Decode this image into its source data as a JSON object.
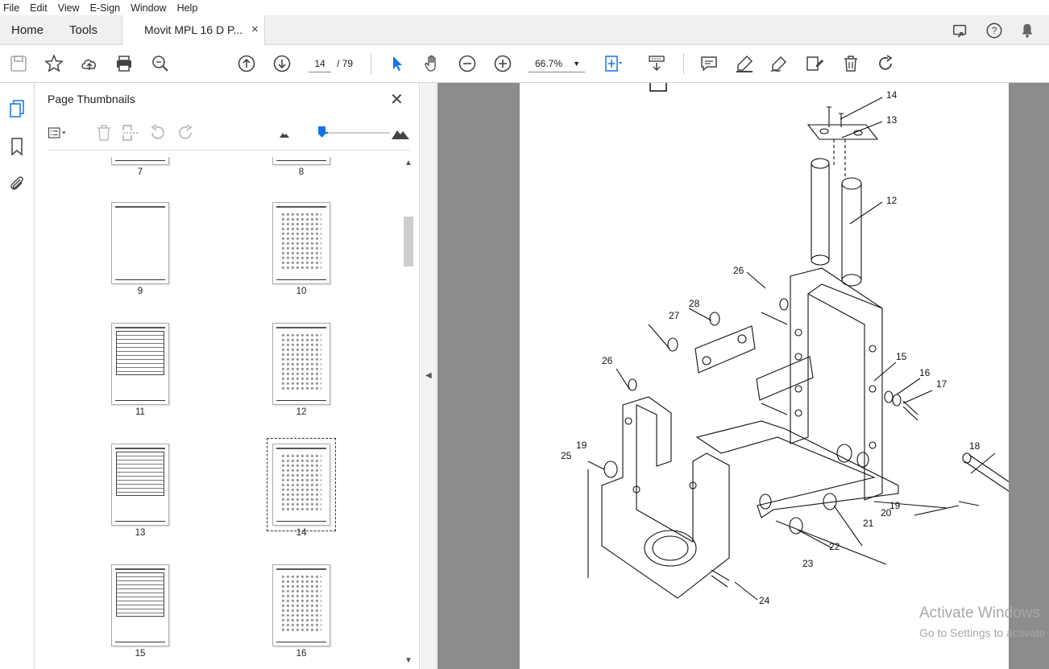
{
  "menu": [
    "File",
    "Edit",
    "View",
    "E-Sign",
    "Window",
    "Help"
  ],
  "tabs": {
    "home": "Home",
    "tools": "Tools",
    "document": "Movit MPL 16 D P...",
    "close": "×"
  },
  "toolbar": {
    "current_page": "14",
    "total_pages": "/ 79",
    "zoom": "66.7%",
    "zoom_dropdown": "▼"
  },
  "panel": {
    "title": "Page Thumbnails",
    "close": "✕",
    "thumbnails": [
      {
        "label": "7"
      },
      {
        "label": "8"
      },
      {
        "label": "9"
      },
      {
        "label": "10"
      },
      {
        "label": "11"
      },
      {
        "label": "12"
      },
      {
        "label": "13"
      },
      {
        "label": "14"
      },
      {
        "label": "15"
      },
      {
        "label": "16"
      }
    ]
  },
  "collapse_arrow": "◀",
  "scroll": {
    "up": "▲",
    "down": "▼"
  },
  "drawing": {
    "callouts": [
      "14",
      "13",
      "12",
      "26",
      "28",
      "27",
      "26",
      "15",
      "16",
      "17",
      "18",
      "19",
      "25",
      "19",
      "20",
      "21",
      "22",
      "23",
      "24"
    ]
  },
  "watermark": {
    "line1": "Activate Windows",
    "line2": "Go to Settings to activate"
  },
  "colors": {
    "accent": "#1473e6",
    "doc_bg": "#8c8c8c"
  }
}
